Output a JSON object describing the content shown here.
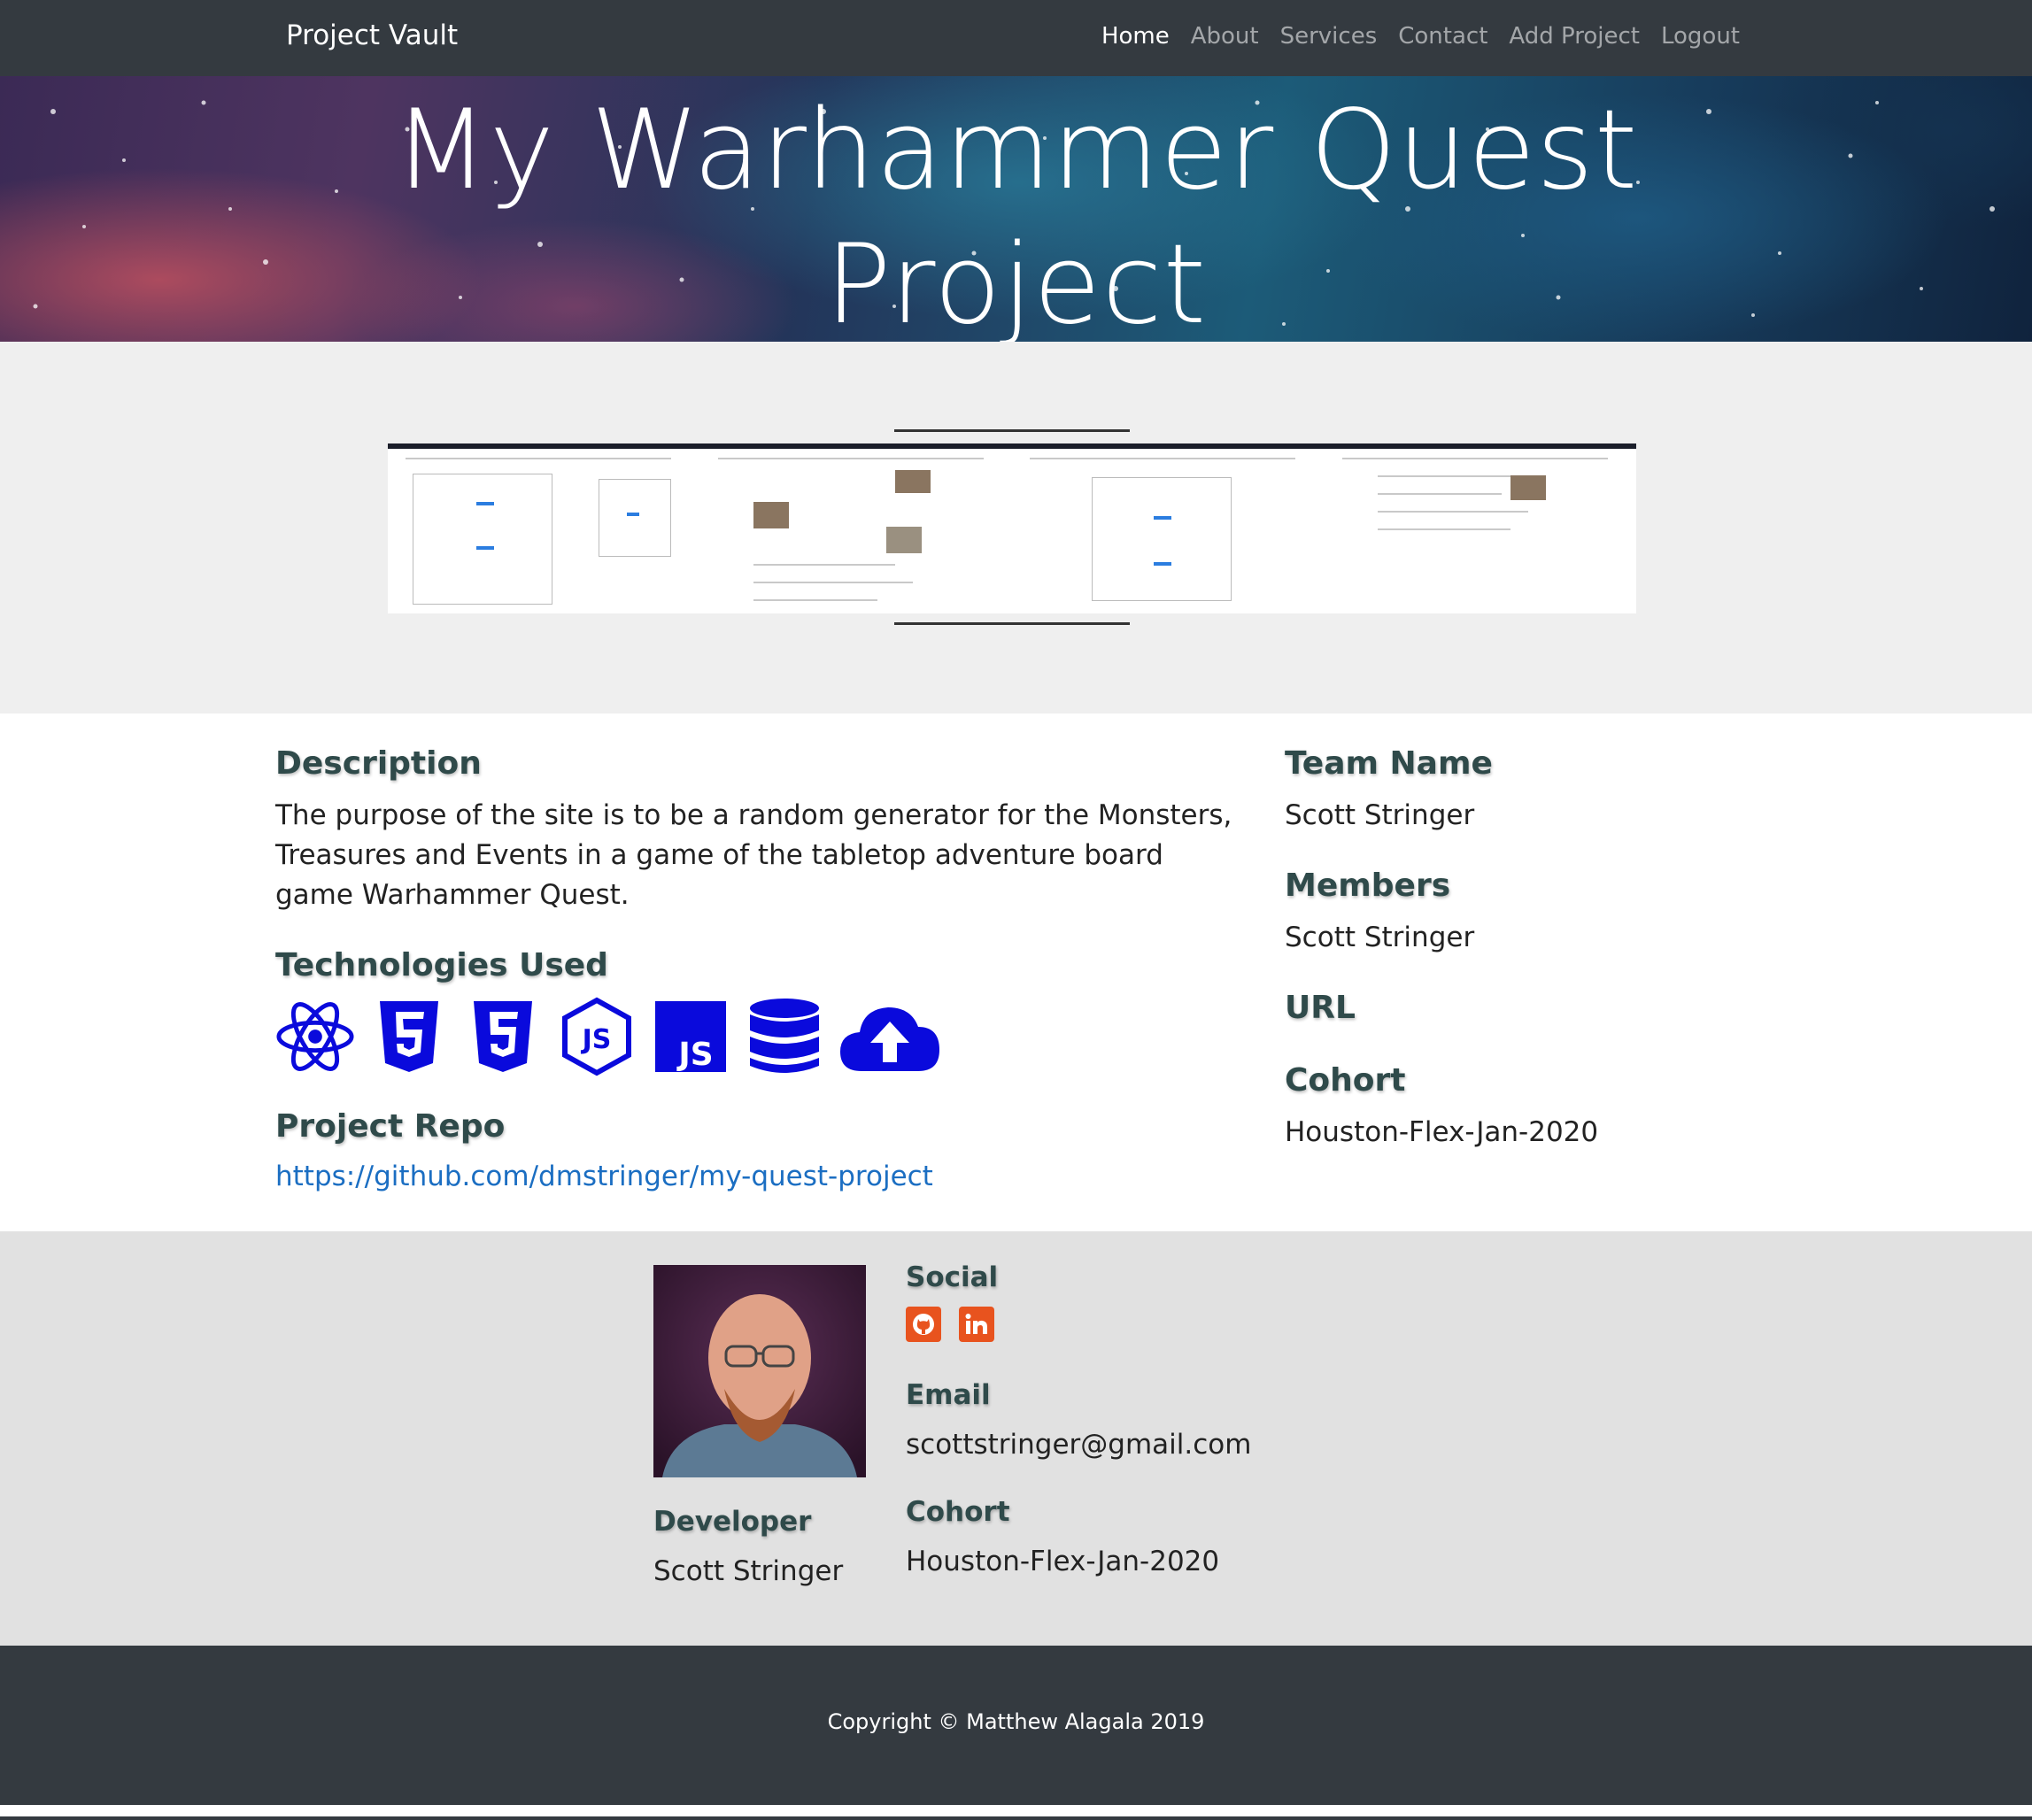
{
  "nav": {
    "brand": "Project Vault",
    "links": [
      "Home",
      "About",
      "Services",
      "Contact",
      "Add Project",
      "Logout"
    ],
    "active": "Home"
  },
  "hero": {
    "title_line1": "My Warhammer Quest",
    "title_line2": "Project"
  },
  "project": {
    "description_heading": "Description",
    "description": "The purpose of the site is to be a random generator for the Monsters, Treasures and Events in a game of the tabletop adventure board game Warhammer Quest.",
    "technologies_heading": "Technologies Used",
    "technologies": [
      "react-icon",
      "html5-icon",
      "css3-icon",
      "nodejs-icon",
      "javascript-icon",
      "database-icon",
      "cloud-upload-icon"
    ],
    "repo_heading": "Project Repo",
    "repo_url": "https://github.com/dmstringer/my-quest-project",
    "team_name_heading": "Team Name",
    "team_name": "Scott Stringer",
    "members_heading": "Members",
    "members": "Scott Stringer",
    "url_heading": "URL",
    "cohort_heading": "Cohort",
    "cohort": "Houston-Flex-Jan-2020"
  },
  "developer": {
    "role_heading": "Developer",
    "name": "Scott Stringer",
    "social_heading": "Social",
    "social": [
      "github-icon",
      "linkedin-icon"
    ],
    "email_heading": "Email",
    "email": "scottstringer@gmail.com",
    "cohort_heading": "Cohort",
    "cohort": "Houston-Flex-Jan-2020"
  },
  "footer": {
    "copyright": "Copyright © Matthew Alagala 2019"
  },
  "colors": {
    "navbar": "#343a40",
    "heading": "#2f4a4a",
    "link": "#1b6ec2",
    "tech_icons": "#0a0adc",
    "social_icons": "#e8531e"
  }
}
